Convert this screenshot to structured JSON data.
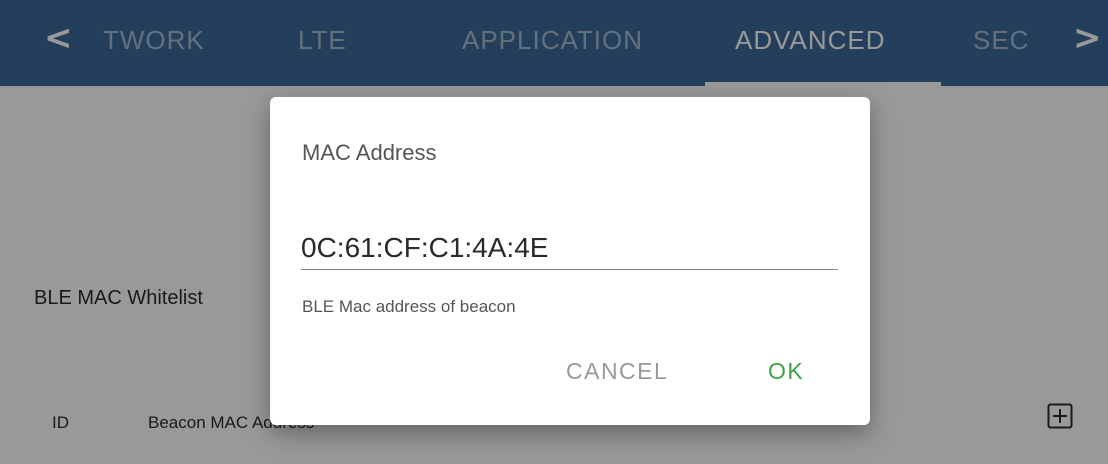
{
  "tabbar": {
    "prev_arrow": "<",
    "next_arrow": ">",
    "tabs": [
      {
        "label": "TWORK"
      },
      {
        "label": "LTE"
      },
      {
        "label": "APPLICATION"
      },
      {
        "label": "ADVANCED"
      },
      {
        "label": "SEC"
      }
    ],
    "active_tab": "ADVANCED",
    "background_color": "#3d6a99"
  },
  "main": {
    "whitelist_label": "BLE MAC Whitelist",
    "table": {
      "columns": [
        "ID",
        "Beacon MAC Address"
      ]
    },
    "add_icon": "plus-square-icon"
  },
  "dialog": {
    "title": "MAC Address",
    "input_value": "0C:61:CF:C1:4A:4E",
    "helper_text": "BLE Mac address of beacon",
    "cancel_label": "CANCEL",
    "ok_label": "OK",
    "ok_color": "#43a047"
  }
}
